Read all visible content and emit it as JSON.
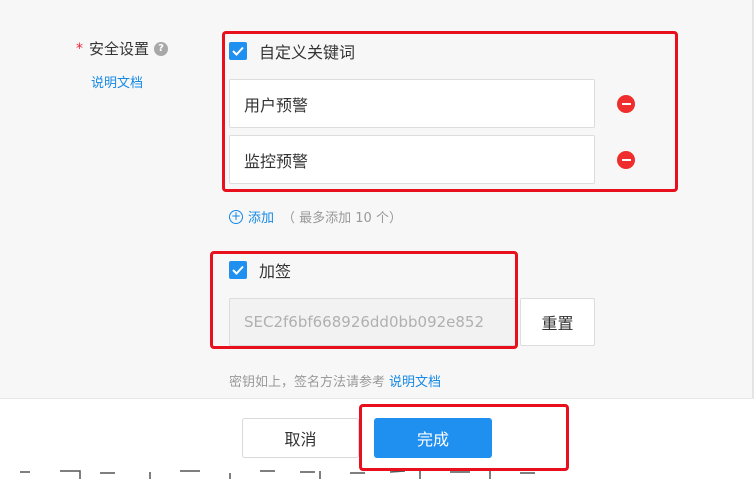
{
  "security": {
    "label": "安全设置",
    "required_mark": "*",
    "help_icon": "question-circle-icon",
    "doc_link": "说明文档"
  },
  "keywords": {
    "checkbox_label": "自定义关键词",
    "checked": true,
    "items": [
      "用户预警",
      "监控预警"
    ],
    "add_label": "添加",
    "add_hint": "（ 最多添加 10 个）"
  },
  "signing": {
    "checkbox_label": "加签",
    "checked": true,
    "secret_value": "SEC2f6bf668926dd0bb092e852",
    "reset_label": "重置",
    "hint_text": "密钥如上，签名方法请参考",
    "hint_link": "说明文档"
  },
  "footer": {
    "cancel_label": "取消",
    "done_label": "完成"
  },
  "colors": {
    "accent": "#1f8ff0",
    "link": "#1589e6",
    "danger": "#f02d2d",
    "highlight_box": "#e8101c"
  }
}
